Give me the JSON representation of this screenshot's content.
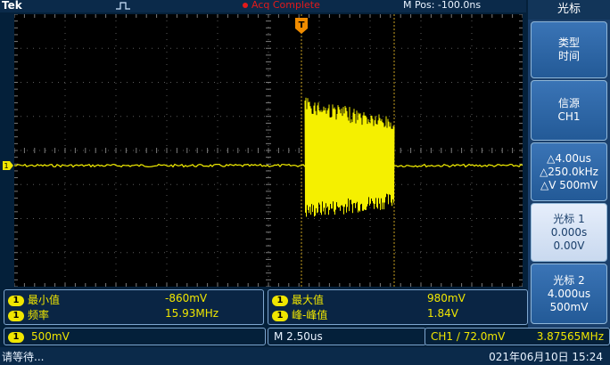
{
  "topbar": {
    "brand": "Tek",
    "acq_status": "Acq Complete",
    "m_pos": "M Pos: -100.0ns"
  },
  "side_menu": {
    "title": "光标",
    "items": [
      {
        "line1": "类型",
        "line2": "时间"
      },
      {
        "line1": "信源",
        "line2": "CH1"
      },
      {
        "line1": "△4.00us",
        "line2": "△250.0kHz",
        "line3": "△V 500mV"
      },
      {
        "line1": "光标 1",
        "line2": "0.000s",
        "line3": "0.00V"
      },
      {
        "line1": "光标 2",
        "line2": "4.000us",
        "line3": "500mV"
      }
    ]
  },
  "measurements": {
    "left": [
      {
        "ch": "1",
        "label": "最小值",
        "value": "-860mV"
      },
      {
        "ch": "1",
        "label": "频率",
        "value": "15.93MHz"
      }
    ],
    "right": [
      {
        "ch": "1",
        "label": "最大值",
        "value": "980mV"
      },
      {
        "ch": "1",
        "label": "峰-峰值",
        "value": "1.84V"
      }
    ]
  },
  "status": {
    "ch1_scale_ch": "1",
    "ch1_scale": "500mV",
    "timebase": "M 2.50us",
    "trigger": "CH1 ∕ 72.0mV",
    "trigger_freq": "3.87565MHz"
  },
  "bottom": {
    "message": "请等待...",
    "datetime": "021年06月10日 15:24"
  },
  "waveform_marker": "1",
  "trigger_marker": "T",
  "colors": {
    "trace": "#f5f000",
    "grid": "#5a5a5a",
    "background": "#000000",
    "panel": "#1a3f6b",
    "accent_blue": "#3a74b6"
  },
  "icons": [
    "trigger-mode-icon",
    "ch1-ground-marker-icon",
    "trigger-position-icon"
  ]
}
